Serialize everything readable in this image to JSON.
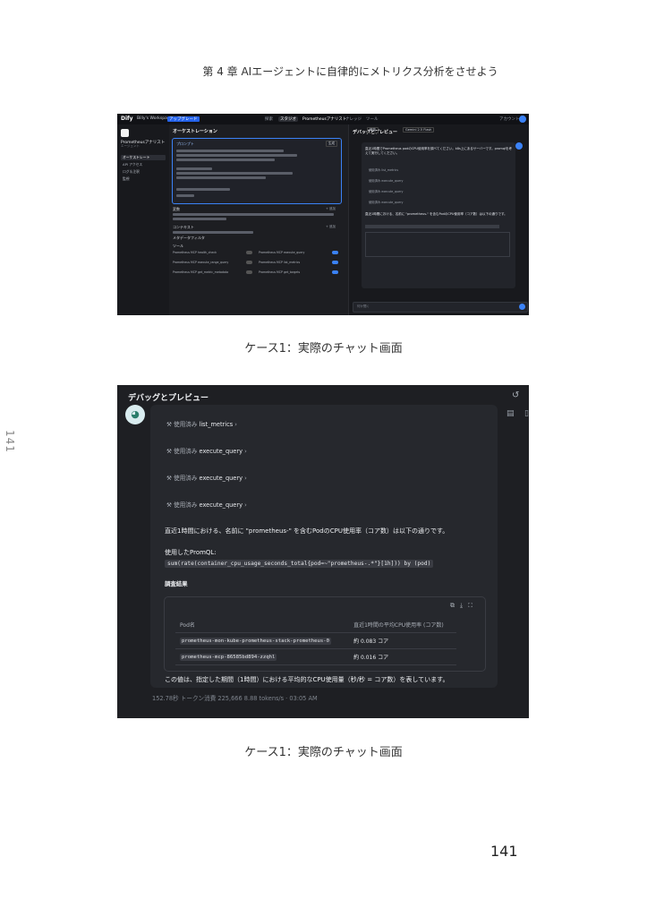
{
  "page": {
    "header_title": "第 4 章 AIエージェントに自律的にメトリクス分析をさせよう",
    "caption_1": "ケース1：実際のチャット画面",
    "caption_2": "ケース1：実際のチャット画面",
    "side_page_number": "141",
    "page_number": "141"
  },
  "screenshot_1": {
    "topbar": {
      "logo": "Dify",
      "workspace": "Billy's Workspace",
      "upgrade": "アップグレード",
      "nav_explore": "探索",
      "nav_studio": "スタジオ",
      "app_name": "Prometheusアナリスト",
      "nav_knowledge": "ナレッジ",
      "nav_tools": "ツール",
      "account": "アカウント"
    },
    "sidebar": {
      "app_name": "Prometheusアナリスト",
      "app_type": "エージェント",
      "items": [
        {
          "label": "オーケストレート"
        },
        {
          "label": "API アクセス"
        },
        {
          "label": "ログ＆注釈"
        },
        {
          "label": "監視"
        }
      ]
    },
    "orchestrate": {
      "title": "オーケストレーション",
      "prompt_title": "プロンプト",
      "generate_label": "生成",
      "variables_title": "変数",
      "context_title": "コンテキスト",
      "metadata_title": "メタデータフィルタ",
      "tools_title": "ツール",
      "add_label": "+ 追加",
      "tools": [
        {
          "label": "Prometheus MCP  health_check"
        },
        {
          "label": "Prometheus MCP  execute_query"
        },
        {
          "label": "Prometheus MCP  execute_range_query"
        },
        {
          "label": "Prometheus MCP  list_metrics"
        },
        {
          "label": "Prometheus MCP  get_metric_metadata"
        },
        {
          "label": "Prometheus MCP  get_targets"
        }
      ]
    },
    "preview": {
      "title": "デバッグとプレビュー",
      "user_message": "直近1時間でPrometheus podのCPU使用率を調べてください。k8s上にあるサーバーです。promqlを考えて実行してください。",
      "tool_uses": [
        "使用済み list_metrics",
        "使用済み execute_query",
        "使用済み execute_query",
        "使用済み execute_query"
      ],
      "answer_line": "直近1時間における、名前に \"prometheus-\" を含むPodのCPU使用率（コア数）は以下の通りです。",
      "input_placeholder": "何か聞く",
      "btn_features": "機能",
      "btn_model": "Gemini 2.5 Flash"
    }
  },
  "screenshot_2": {
    "title": "デバッグとプレビュー",
    "tool_uses": [
      {
        "prefix": "使用済み",
        "name": "list_metrics"
      },
      {
        "prefix": "使用済み",
        "name": "execute_query"
      },
      {
        "prefix": "使用済み",
        "name": "execute_query"
      },
      {
        "prefix": "使用済み",
        "name": "execute_query"
      }
    ],
    "answer_line": "直近1時間における、名前に \"prometheus-\" を含むPodのCPU使用率（コア数）は以下の通りです。",
    "promql_label": "使用したPromQL:",
    "promql": "sum(rate(container_cpu_usage_seconds_total{pod=~\"prometheus-.*\"}[1h])) by (pod)",
    "results_heading": "調査結果",
    "table": {
      "headers": [
        "Pod名",
        "直近1時間の平均CPU使用率 (コア数)"
      ],
      "rows": [
        [
          "prometheus-mon-kube-prometheus-stack-prometheus-0",
          "約 0.083 コア"
        ],
        [
          "prometheus-mcp-86585bd894-zzqhl",
          "約 0.016 コア"
        ]
      ]
    },
    "conclusion": "この値は、指定した期間（1時間）における平均的なCPU使用量（秒/秒 = コア数）を表しています。",
    "footer": "152.78秒  トークン消費 225,666  8.88 tokens/s  ·  03:05 AM"
  }
}
